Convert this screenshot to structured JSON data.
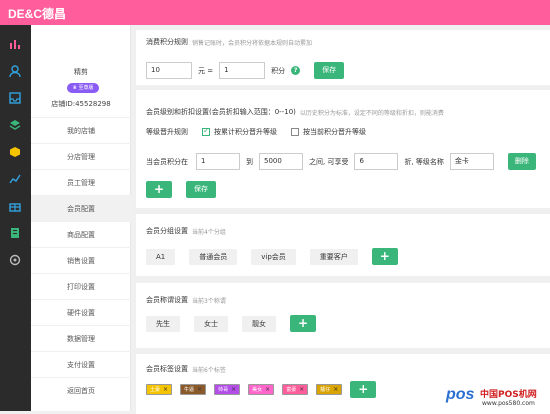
{
  "brand": {
    "logo": "DE&C德昌",
    "color": "#ff5d9b"
  },
  "user": {
    "name": "精剪",
    "vip": "至尊版",
    "store_id": "店铺ID:45528298"
  },
  "sidebar": {
    "items": [
      {
        "label": "我的店铺"
      },
      {
        "label": "分店管理"
      },
      {
        "label": "员工管理"
      },
      {
        "label": "会员配置",
        "active": true
      },
      {
        "label": "商品配置"
      },
      {
        "label": "销售设置"
      },
      {
        "label": "打印设置"
      },
      {
        "label": "硬件设置"
      },
      {
        "label": "数据管理"
      },
      {
        "label": "支付设置"
      },
      {
        "label": "返回首页"
      }
    ]
  },
  "rail_icons": [
    "bar-chart-icon",
    "user-icon",
    "inbox-icon",
    "layers-icon",
    "box-icon",
    "trend-icon",
    "gift-icon",
    "clipboard-icon",
    "settings-icon"
  ],
  "points": {
    "title": "消费积分规则",
    "hint": "销售记账时，会员积分将依据本规则自动累加",
    "amount": "10",
    "yuan_eq": "元 =",
    "points_val": "1",
    "unit": "积分",
    "save": "保存"
  },
  "level": {
    "title": "会员级别和折扣设置(会员折扣输入范围：0--10)",
    "hint": "以历史积分为标准，设定不同的等级和折扣，则能消费",
    "rule_label": "等级晋升规则",
    "opt1": "按累计积分晋升等级",
    "opt2": "按当前积分晋升等级",
    "row_label": "当会员积分在",
    "from": "1",
    "to_label": "到",
    "to": "5000",
    "between": "之间, 可享受",
    "discount": "6",
    "discount_unit": "折, 等级名称",
    "name": "金卡",
    "delete": "删除",
    "add": "+",
    "save": "保存"
  },
  "groups": {
    "title": "会员分组设置",
    "hint": "当前4个分组",
    "items": [
      "A1",
      "普通会员",
      "vip会员",
      "重要客户"
    ],
    "add": "+"
  },
  "titles": {
    "title": "会员称谓设置",
    "hint": "当前3个称谓",
    "items": [
      "先生",
      "女士",
      "靓女"
    ],
    "add": "+"
  },
  "tags": {
    "title": "会员标签设置",
    "hint": "当前6个标签",
    "items": [
      {
        "label": "土豪",
        "color": "#f5c400"
      },
      {
        "label": "牛逼",
        "color": "#8b5a2b"
      },
      {
        "label": "帅哥",
        "color": "#b44ee8"
      },
      {
        "label": "美女",
        "color": "#ff66cc"
      },
      {
        "label": "富豪",
        "color": "#ff5d9b"
      },
      {
        "label": "靓仔",
        "color": "#d9a300"
      }
    ],
    "add": "+"
  },
  "watermark": {
    "main": "中国POS机网",
    "sub": "www.pos580.com",
    "logo": "pos"
  },
  "colors": {
    "accent": "#3bb67a",
    "vip": "#8a5cf6"
  }
}
